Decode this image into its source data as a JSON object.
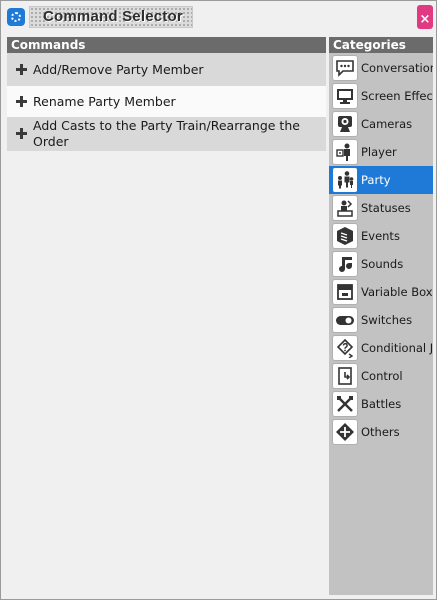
{
  "window": {
    "title": "Command Selector",
    "close_glyph": "×"
  },
  "commands": {
    "header": "Commands",
    "items": [
      {
        "label": "Add/Remove Party Member"
      },
      {
        "label": "Rename Party Member"
      },
      {
        "label": "Add Casts to the Party Train/Rearrange the Order"
      }
    ]
  },
  "categories": {
    "header": "Categories",
    "selected": "Party",
    "items": [
      {
        "label": "Conversation",
        "icon": "speech-bubble-icon"
      },
      {
        "label": "Screen Effects",
        "icon": "monitor-icon"
      },
      {
        "label": "Cameras",
        "icon": "camera-icon"
      },
      {
        "label": "Player",
        "icon": "player-icon"
      },
      {
        "label": "Party",
        "icon": "party-icon"
      },
      {
        "label": "Statuses",
        "icon": "statuses-icon"
      },
      {
        "label": "Events",
        "icon": "events-icon"
      },
      {
        "label": "Sounds",
        "icon": "music-note-icon"
      },
      {
        "label": "Variable Boxes",
        "icon": "variable-box-icon"
      },
      {
        "label": "Switches",
        "icon": "switch-icon"
      },
      {
        "label": "Conditional Jumps",
        "icon": "conditional-jump-icon"
      },
      {
        "label": "Control",
        "icon": "control-icon"
      },
      {
        "label": "Battles",
        "icon": "battles-icon"
      },
      {
        "label": "Others",
        "icon": "others-icon"
      }
    ]
  },
  "colors": {
    "accent": "#1e7ad6",
    "close": "#e03a83",
    "header": "#6b6b6b"
  }
}
